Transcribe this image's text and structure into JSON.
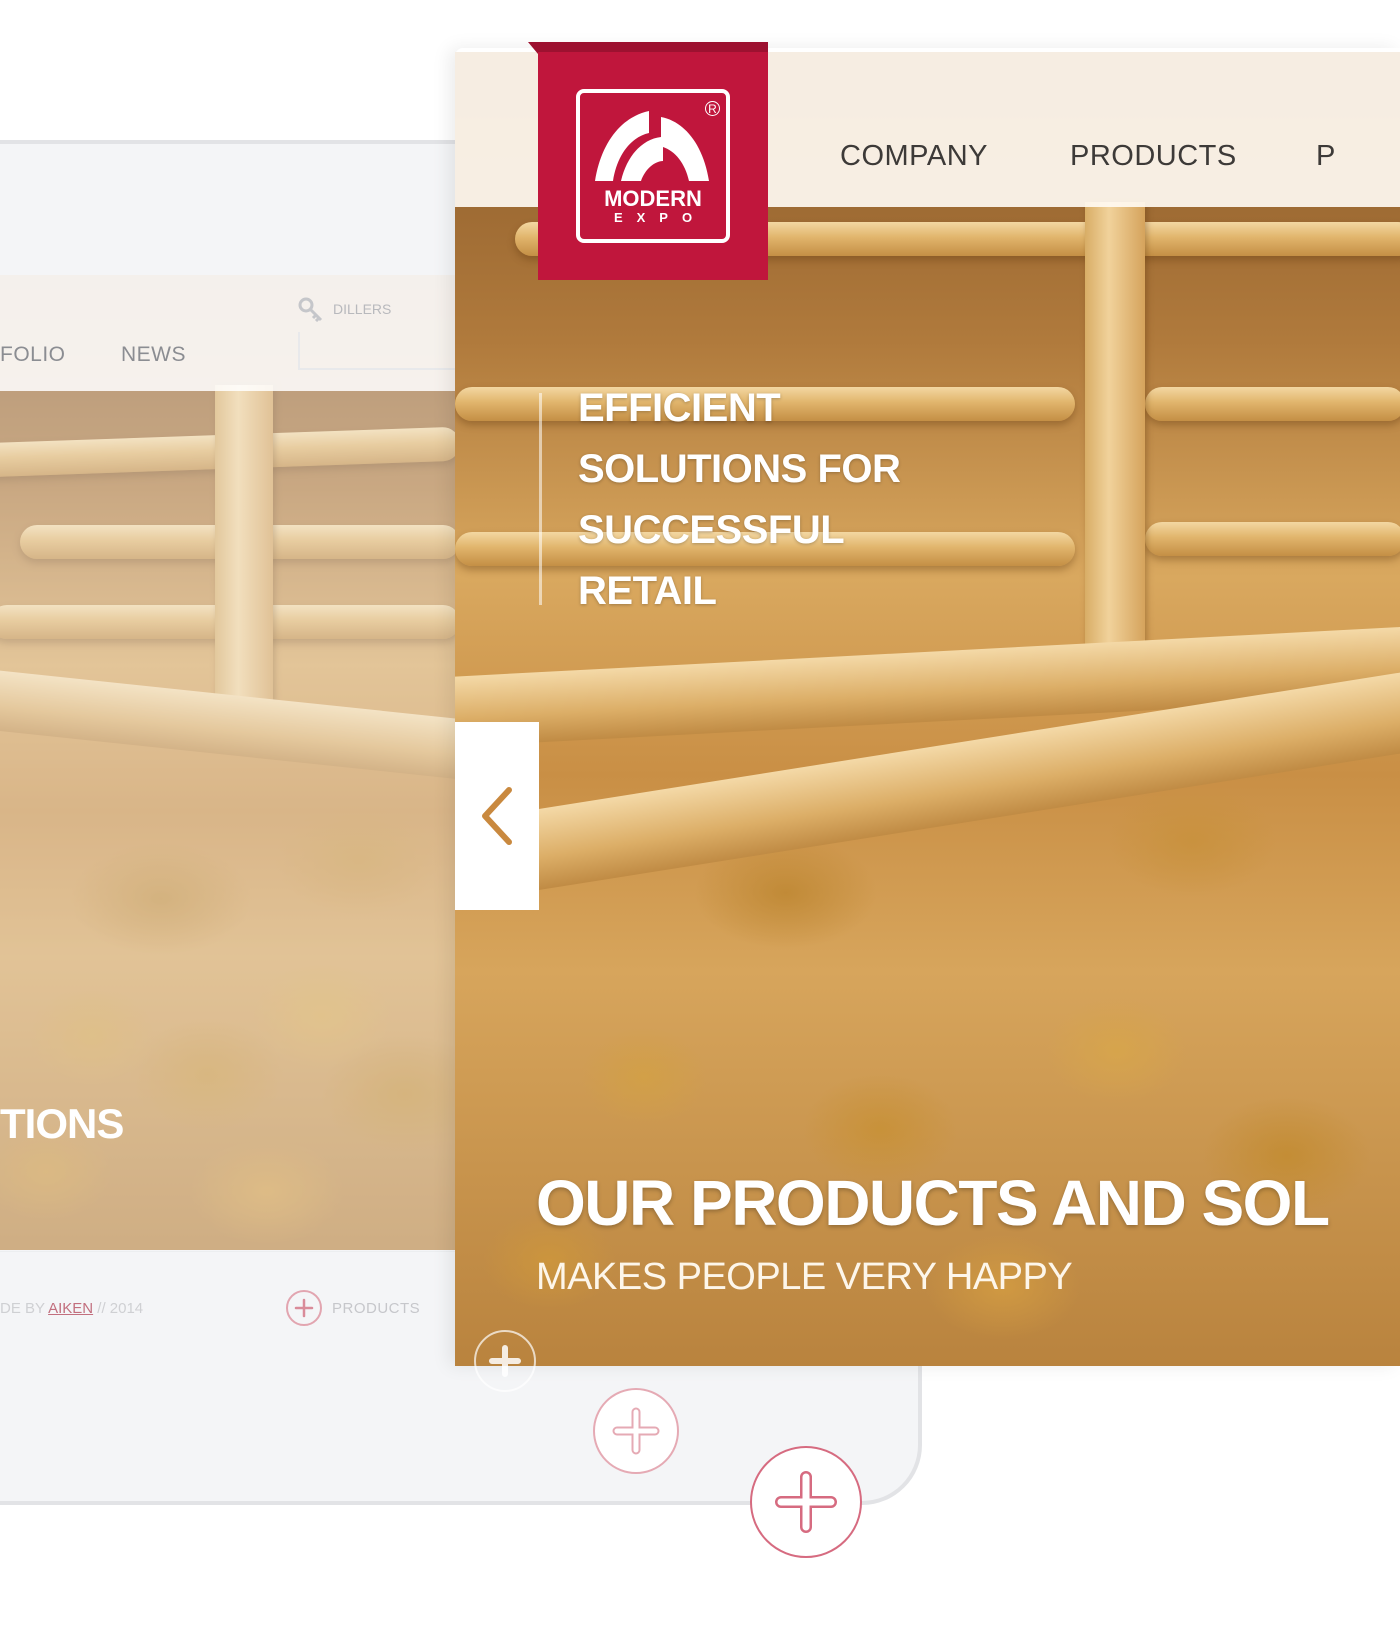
{
  "back_tablet": {
    "nav": [
      "FOLIO",
      "NEWS"
    ],
    "dillers_label": "DILLERS",
    "headline_fragment": "TIONS",
    "footer": {
      "credit_prefix": "DE BY ",
      "credit_author": "AIKEN",
      "credit_suffix": " // 2014",
      "products_label": "PRODUCTS"
    }
  },
  "front_tablet": {
    "logo": {
      "line1": "MODERN",
      "line2": "EXPO",
      "reg_mark": "R"
    },
    "nav": [
      "COMPANY",
      "PRODUCTS",
      "P"
    ],
    "hero": [
      "EFFICIENT",
      "SOLUTIONS FOR",
      "SUCCESSFUL",
      "RETAIL"
    ],
    "title": "OUR PRODUCTS AND SOL",
    "subtitle": "MAKES PEOPLE VERY HAPPY"
  },
  "colors": {
    "brand_red": "#c0163c",
    "plus_accent": "#d66b80"
  },
  "icons": [
    "key-icon",
    "chevron-left-icon",
    "plus-icon"
  ]
}
